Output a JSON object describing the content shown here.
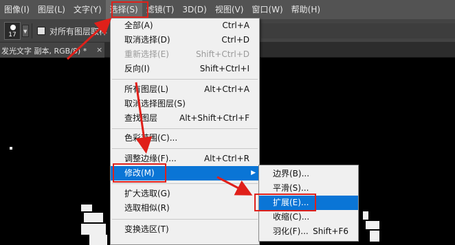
{
  "menubar": {
    "items": [
      "图像(I)",
      "图层(L)",
      "文字(Y)",
      "选择(S)",
      "滤镜(T)",
      "3D(D)",
      "视图(V)",
      "窗口(W)",
      "帮助(H)"
    ]
  },
  "options_bar": {
    "brush_size": "17",
    "checkbox_label": "对所有图层取样"
  },
  "document_tab": {
    "title": "发光文字 副本, RGB/8) *",
    "close": "×"
  },
  "select_menu": {
    "items": [
      {
        "label": "全部(A)",
        "shortcut": "Ctrl+A"
      },
      {
        "label": "取消选择(D)",
        "shortcut": "Ctrl+D"
      },
      {
        "label": "重新选择(E)",
        "shortcut": "Shift+Ctrl+D",
        "disabled": true
      },
      {
        "label": "反向(I)",
        "shortcut": "Shift+Ctrl+I"
      },
      {
        "label": "所有图层(L)",
        "shortcut": "Alt+Ctrl+A"
      },
      {
        "label": "取消选择图层(S)",
        "shortcut": ""
      },
      {
        "label": "查找图层",
        "shortcut": "Alt+Shift+Ctrl+F"
      },
      {
        "label": "色彩范围(C)...",
        "shortcut": ""
      },
      {
        "label": "调整边缘(F)...",
        "shortcut": "Alt+Ctrl+R"
      },
      {
        "label": "修改(M)",
        "shortcut": "",
        "submenu": true,
        "highlighted": true
      },
      {
        "label": "扩大选取(G)",
        "shortcut": ""
      },
      {
        "label": "选取相似(R)",
        "shortcut": ""
      },
      {
        "label": "变换选区(T)",
        "shortcut": ""
      }
    ]
  },
  "modify_submenu": {
    "items": [
      {
        "label": "边界(B)...",
        "shortcut": ""
      },
      {
        "label": "平滑(S)...",
        "shortcut": ""
      },
      {
        "label": "扩展(E)...",
        "shortcut": "",
        "highlighted": true
      },
      {
        "label": "收缩(C)...",
        "shortcut": ""
      },
      {
        "label": "羽化(F)...",
        "shortcut": "Shift+F6"
      }
    ]
  },
  "colors": {
    "highlight": "#0a75d6",
    "annotation_red": "#e0201a"
  }
}
